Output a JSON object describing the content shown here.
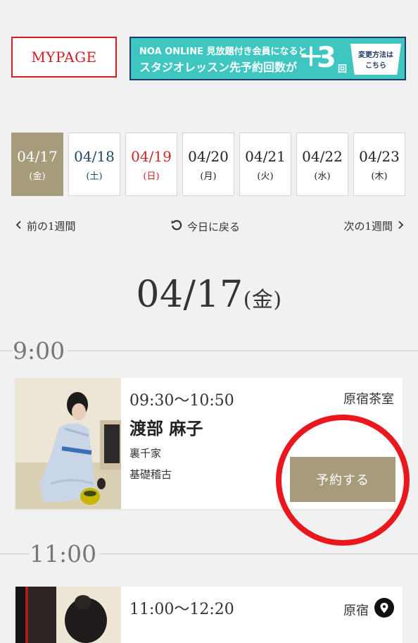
{
  "header": {
    "mypage_label": "MYPAGE",
    "banner": {
      "line1": "NOA ONLINE 見放題付き会員になると",
      "line2": "スタジオレッスン先予約回数が",
      "plus": "＋",
      "count": "3",
      "unit": "回",
      "howto_line1": "変更方法は",
      "howto_line2": "こちら"
    }
  },
  "dates": [
    {
      "date": "04/17",
      "weekday": "(金)",
      "state": "active"
    },
    {
      "date": "04/18",
      "weekday": "(土)",
      "state": "sat"
    },
    {
      "date": "04/19",
      "weekday": "(日)",
      "state": "sun"
    },
    {
      "date": "04/20",
      "weekday": "(月)",
      "state": "normal"
    },
    {
      "date": "04/21",
      "weekday": "(火)",
      "state": "normal"
    },
    {
      "date": "04/22",
      "weekday": "(水)",
      "state": "normal"
    },
    {
      "date": "04/23",
      "weekday": "(木)",
      "state": "normal"
    }
  ],
  "week_nav": {
    "prev": "前の1週間",
    "today": "今日に戻る",
    "next": "次の1週間"
  },
  "selected_date": {
    "date": "04/17",
    "weekday": "(金)"
  },
  "timeline": {
    "t1": "9:00",
    "t2": "11:00"
  },
  "lessons": [
    {
      "time": "09:30〜10:50",
      "place": "原宿茶室",
      "teacher": "渡部 麻子",
      "school": "裏千家",
      "course": "基礎稽古",
      "button": "予約する"
    },
    {
      "time": "11:00〜12:20",
      "place": "原宿"
    }
  ],
  "colors": {
    "accent": "#a69c7c",
    "brand_red": "#d21d25",
    "saturday": "#1d4868",
    "sunday": "#c82727",
    "banner_bg": "#3fc6c1",
    "highlight_circle": "#e8181e"
  }
}
